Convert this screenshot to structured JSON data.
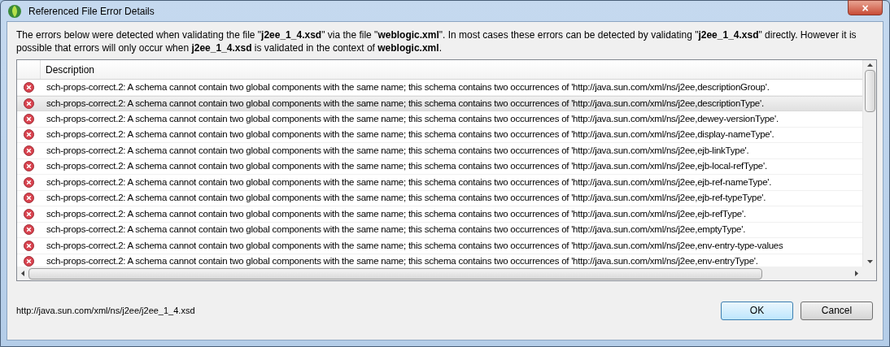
{
  "window": {
    "title": "Referenced File Error Details",
    "close": "×"
  },
  "message": "The errors below were detected when validating the file \"**j2ee_1_4.xsd**\" via the file \"**weblogic.xml**\".  In most cases these errors can be detected by validating \"**j2ee_1_4.xsd**\" directly.  However it is possible that errors will only occur when **j2ee_1_4.xsd** is validated in the context of **weblogic.xml**.",
  "table": {
    "columns": [
      "Description"
    ],
    "rows": [
      {
        "text": "sch-props-correct.2: A schema cannot contain two global components with the same name; this schema contains two occurrences of 'http://java.sun.com/xml/ns/j2ee,descriptionGroup'.",
        "selected": false
      },
      {
        "text": "sch-props-correct.2: A schema cannot contain two global components with the same name; this schema contains two occurrences of 'http://java.sun.com/xml/ns/j2ee,descriptionType'.",
        "selected": true
      },
      {
        "text": "sch-props-correct.2: A schema cannot contain two global components with the same name; this schema contains two occurrences of 'http://java.sun.com/xml/ns/j2ee,dewey-versionType'.",
        "selected": false
      },
      {
        "text": "sch-props-correct.2: A schema cannot contain two global components with the same name; this schema contains two occurrences of 'http://java.sun.com/xml/ns/j2ee,display-nameType'.",
        "selected": false
      },
      {
        "text": "sch-props-correct.2: A schema cannot contain two global components with the same name; this schema contains two occurrences of 'http://java.sun.com/xml/ns/j2ee,ejb-linkType'.",
        "selected": false
      },
      {
        "text": "sch-props-correct.2: A schema cannot contain two global components with the same name; this schema contains two occurrences of 'http://java.sun.com/xml/ns/j2ee,ejb-local-refType'.",
        "selected": false
      },
      {
        "text": "sch-props-correct.2: A schema cannot contain two global components with the same name; this schema contains two occurrences of 'http://java.sun.com/xml/ns/j2ee,ejb-ref-nameType'.",
        "selected": false
      },
      {
        "text": "sch-props-correct.2: A schema cannot contain two global components with the same name; this schema contains two occurrences of 'http://java.sun.com/xml/ns/j2ee,ejb-ref-typeType'.",
        "selected": false
      },
      {
        "text": "sch-props-correct.2: A schema cannot contain two global components with the same name; this schema contains two occurrences of 'http://java.sun.com/xml/ns/j2ee,ejb-refType'.",
        "selected": false
      },
      {
        "text": "sch-props-correct.2: A schema cannot contain two global components with the same name; this schema contains two occurrences of 'http://java.sun.com/xml/ns/j2ee,emptyType'.",
        "selected": false
      },
      {
        "text": "sch-props-correct.2: A schema cannot contain two global components with the same name; this schema contains two occurrences of 'http://java.sun.com/xml/ns/j2ee,env-entry-type-values",
        "selected": false
      },
      {
        "text": "sch-props-correct.2: A schema cannot contain two global components with the same name; this schema contains two occurrences of 'http://java.sun.com/xml/ns/j2ee,env-entryType'.",
        "selected": false
      }
    ]
  },
  "status": "http://java.sun.com/xml/ns/j2ee/j2ee_1_4.xsd",
  "buttons": [
    "OK",
    "Cancel"
  ]
}
